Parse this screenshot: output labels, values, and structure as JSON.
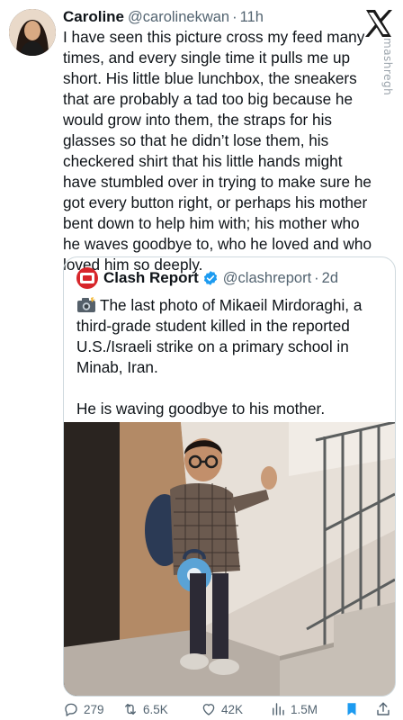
{
  "author": {
    "display_name": "Caroline",
    "handle": "@carolinekwan",
    "separator": "·",
    "time": "11h"
  },
  "tweet_text": "I have seen this picture cross my feed many times, and every single time it pulls me up short. His little blue lunchbox, the sneakers that are probably a tad too big because he would grow into them, the straps for his glasses so that he didn’t lose them, his checkered shirt that his little hands might have stumbled over in trying to make sure he got every button right, or perhaps his mother bent down to help him with; his mother who he waves goodbye to, who he loved and who loved him so deeply.",
  "quoted": {
    "display_name": "Clash Report",
    "handle": "@clashreport",
    "separator": "·",
    "time": "2d",
    "text": "The last photo of Mikaeil Mirdoraghi, a third-grade student killed in the reported U.S./Israeli strike on a primary school in Minab, Iran.\n\nHe is waving goodbye to his mother."
  },
  "watermark": "mashregh",
  "actions": {
    "replies": "279",
    "reposts": "6.5K",
    "likes": "42K",
    "views": "1.5M"
  },
  "icons": {
    "reply": "reply-icon",
    "repost": "repost-icon",
    "like": "heart-icon",
    "views": "views-icon",
    "bookmark": "bookmark-icon",
    "share": "share-icon",
    "verified": "verified-badge-icon",
    "camera": "camera-flash-icon",
    "brand": "x-logo-icon"
  },
  "colors": {
    "text": "#0f1419",
    "muted": "#536471",
    "border": "#cfd9de",
    "bookmark_active": "#1d9bf0",
    "verified": "#1d9bf0",
    "clash_brand": "#d7262b"
  }
}
